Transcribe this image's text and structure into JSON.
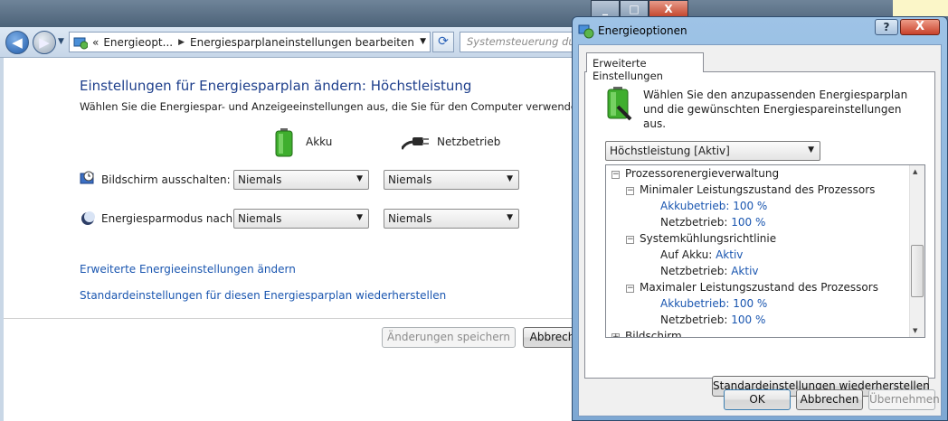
{
  "window_controls": {
    "minimize": "_",
    "maximize": "□",
    "close": "X"
  },
  "nav": {
    "breadcrumb_prefix": "«",
    "breadcrumb": [
      "Energieopt...",
      "Energiesparplaneinstellungen bearbeiten"
    ],
    "search_placeholder": "Systemsteuerung durchsuchen",
    "refresh_glyph": "⟳",
    "back_glyph": "◀",
    "forward_glyph": "▶"
  },
  "page": {
    "title": "Einstellungen für Energiesparplan ändern: Höchstleistung",
    "subtitle": "Wählen Sie die Energiespar- und Anzeigeeinstellungen aus, die Sie für den Computer verwenden möchten.",
    "columns": {
      "battery": "Akku",
      "plugged": "Netzbetrieb"
    },
    "settings": [
      {
        "label": "Bildschirm ausschalten:",
        "battery": "Niemals",
        "plugged": "Niemals",
        "icon": "display-clock-icon"
      },
      {
        "label": "Energiesparmodus nach:",
        "battery": "Niemals",
        "plugged": "Niemals",
        "icon": "moon-icon"
      }
    ],
    "links": {
      "advanced": "Erweiterte Energieeinstellungen ändern",
      "restore_defaults": "Standardeinstellungen für diesen Energiesparplan wiederherstellen"
    },
    "buttons": {
      "save": "Änderungen speichern",
      "cancel": "Abbrechen"
    }
  },
  "dialog": {
    "title": "Energieoptionen",
    "help": "?",
    "close": "X",
    "tab": "Erweiterte Einstellungen",
    "description": "Wählen Sie den anzupassenden Energiesparplan und die gewünschten Energiespareinstellungen aus.",
    "plan_selected": "Höchstleistung [Aktiv]",
    "tree": [
      {
        "text": "Prozessorenergieverwaltung",
        "expander": "−",
        "level": 0
      },
      {
        "text": "Minimaler Leistungszustand des Prozessors",
        "expander": "−",
        "level": 1
      },
      {
        "key": "Akkubetrieb:",
        "value": "100 %",
        "level": 2,
        "key_link": true
      },
      {
        "key": "Netzbetrieb:",
        "value": "100 %",
        "level": 2
      },
      {
        "text": "Systemkühlungsrichtlinie",
        "expander": "−",
        "level": 1
      },
      {
        "key": "Auf Akku:",
        "value": "Aktiv",
        "level": 2
      },
      {
        "key": "Netzbetrieb:",
        "value": "Aktiv",
        "level": 2
      },
      {
        "text": "Maximaler Leistungszustand des Prozessors",
        "expander": "−",
        "level": 1
      },
      {
        "key": "Akkubetrieb:",
        "value": "100 %",
        "level": 2,
        "key_link": true
      },
      {
        "key": "Netzbetrieb:",
        "value": "100 %",
        "level": 2
      },
      {
        "text": "Bildschirm",
        "expander": "+",
        "level": 0
      }
    ],
    "restore_button": "Standardeinstellungen wiederherstellen",
    "ok": "OK",
    "cancel": "Abbrechen",
    "apply": "Übernehmen"
  },
  "colors": {
    "link": "#1a56b0",
    "title_blue": "#1e3f8c",
    "dialog_frame": "#9ec3e6"
  }
}
